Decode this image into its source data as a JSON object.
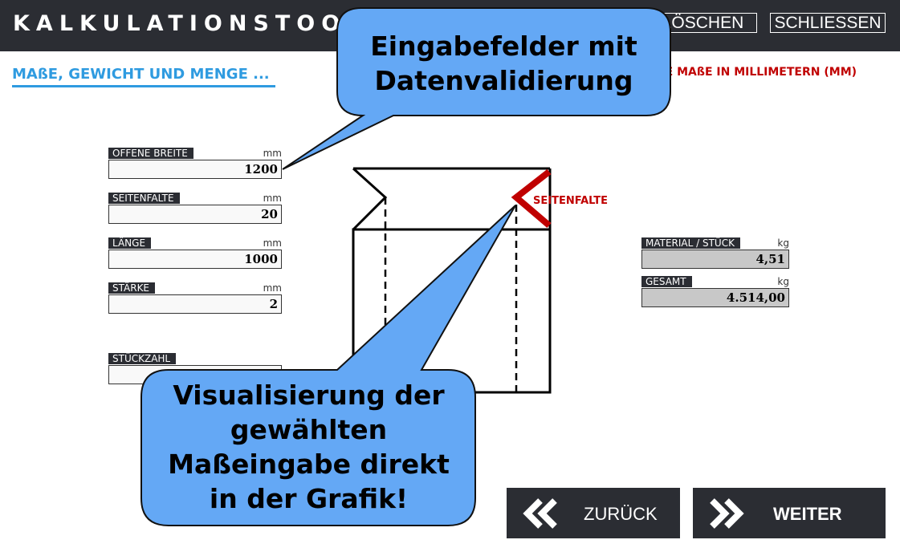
{
  "header": {
    "app_title": "KALKULATIONSTOOL",
    "delete_label": "LÖSCHEN",
    "close_label": "SCHLIESSEN"
  },
  "section": {
    "title": "MAßE, GEWICHT UND MENGE ...",
    "note": "ALLE MAßE IN MILLIMETERN (MM)"
  },
  "inputs": {
    "open_width": {
      "label": "OFFENE BREITE",
      "unit": "mm",
      "value": "1200"
    },
    "side_gusset": {
      "label": "SEITENFALTE",
      "unit": "mm",
      "value": "20"
    },
    "length": {
      "label": "LÄNGE",
      "unit": "mm",
      "value": "1000"
    },
    "thickness": {
      "label": "STÄRKE",
      "unit": "mm",
      "value": "2"
    },
    "quantity": {
      "label": "STÜCKZAHL",
      "value": ""
    }
  },
  "outputs": {
    "material_per_piece": {
      "label": "MATERIAL / STÜCK",
      "unit": "kg",
      "value": "4,51"
    },
    "total": {
      "label": "GESAMT",
      "unit": "kg",
      "value": "4.514,00"
    }
  },
  "graphic": {
    "gusset_label": "SEITENFALTE"
  },
  "callouts": {
    "top": "Eingabefelder mit Datenvalidierung",
    "bottom": "Visualisierung der gewählten Maßeingabe direkt in der Grafik!"
  },
  "nav": {
    "back_label": "ZURÜCK",
    "next_label": "WEITER"
  },
  "colors": {
    "header_bg": "#2b2d33",
    "accent_blue": "#2f9be0",
    "note_red": "#c00000",
    "callout_fill": "#64a8f5"
  }
}
